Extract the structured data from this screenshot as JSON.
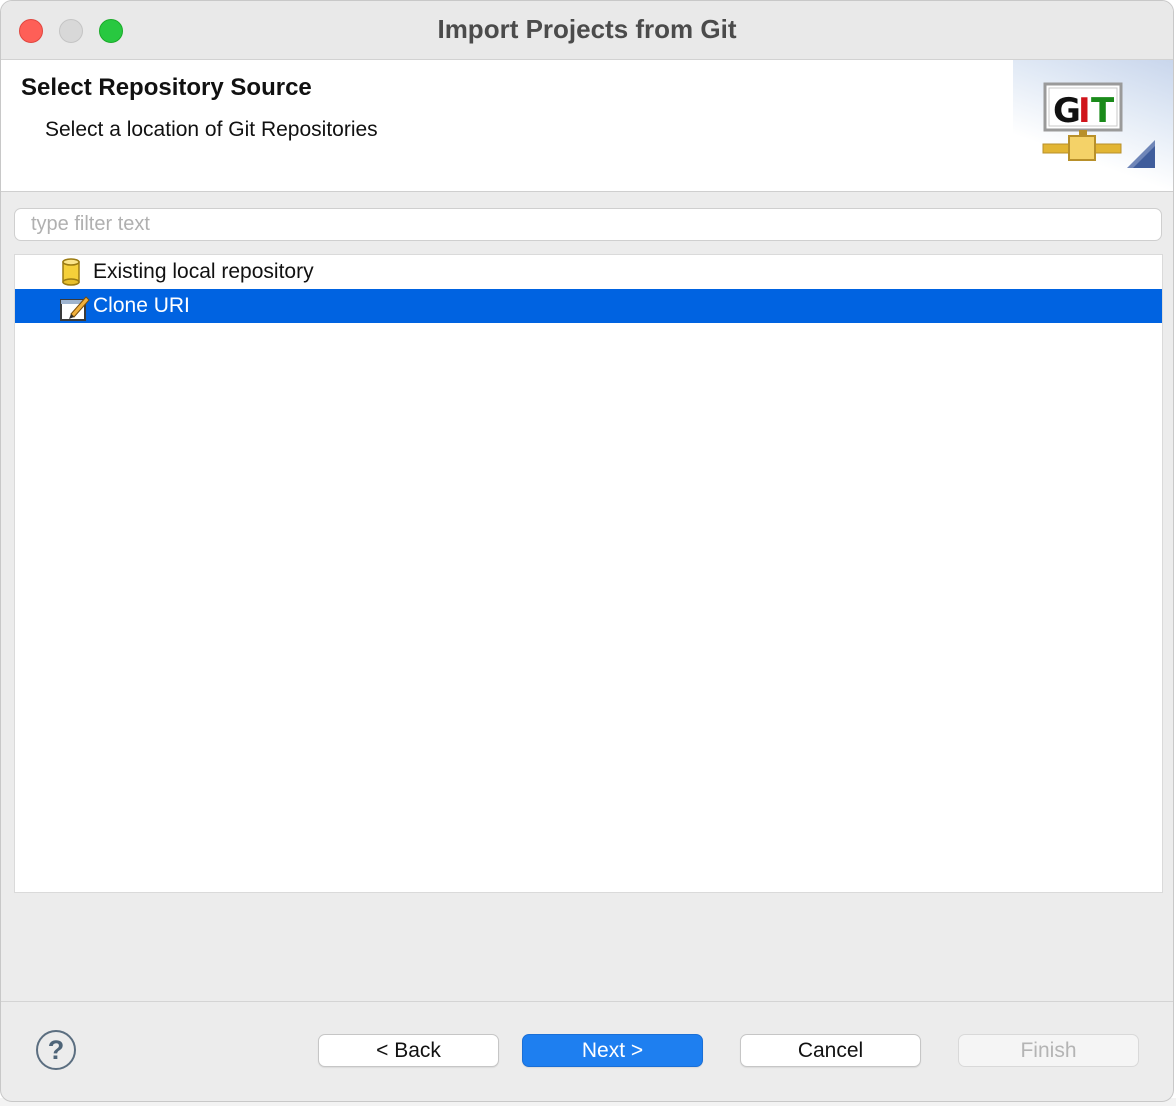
{
  "window": {
    "title": "Import Projects from Git"
  },
  "banner": {
    "title": "Select Repository Source",
    "description": "Select a location of Git Repositories",
    "logo_text": "GIT"
  },
  "filter": {
    "placeholder": "type filter text",
    "value": ""
  },
  "tree": {
    "items": [
      {
        "label": "Existing local repository",
        "icon": "repository-cylinder-icon",
        "selected": false
      },
      {
        "label": "Clone URI",
        "icon": "clone-uri-icon",
        "selected": true
      }
    ]
  },
  "buttons": {
    "help": "?",
    "back": "< Back",
    "next": "Next >",
    "cancel": "Cancel",
    "finish": "Finish"
  },
  "colors": {
    "selection": "#0063e1",
    "primary_button": "#1e7ff0",
    "close": "#fe5f57",
    "zoom": "#28c840"
  }
}
